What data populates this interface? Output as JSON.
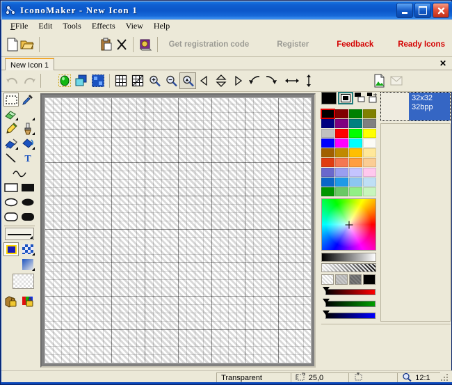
{
  "window": {
    "title": "IconoMaker - New Icon 1",
    "app_icon": "iconomaker-icon",
    "minimize_label": "",
    "maximize_label": "",
    "close_label": "✕"
  },
  "menubar": {
    "items": [
      {
        "label": "File",
        "accel": "F"
      },
      {
        "label": "Edit",
        "accel": "E"
      },
      {
        "label": "Tools",
        "accel": "T"
      },
      {
        "label": "Effects",
        "accel": "c"
      },
      {
        "label": "View",
        "accel": "V"
      },
      {
        "label": "Help",
        "accel": "H"
      }
    ]
  },
  "toolbar_main": {
    "buttons": [
      {
        "name": "new-icon-button",
        "icon": "new-document-icon"
      },
      {
        "name": "open-icon-button",
        "icon": "open-folder-icon"
      },
      {
        "name": "paste-button",
        "icon": "clipboard-paste-icon"
      },
      {
        "name": "delete-button",
        "icon": "delete-x-icon"
      },
      {
        "name": "library-button",
        "icon": "book-icon"
      }
    ],
    "get_registration_code": "Get registration code",
    "register": "Register",
    "feedback": "Feedback",
    "ready_icons": "Ready Icons",
    "disabled_color": "#9b9b94",
    "accent_color": "#d40000"
  },
  "tabs": {
    "items": [
      {
        "label": "New Icon 1",
        "active": true
      }
    ],
    "close_label": "✕"
  },
  "toolbar_edit": {
    "undo": {
      "name": "undo-button",
      "icon": "undo-arrow-icon",
      "enabled": false
    },
    "redo": {
      "name": "redo-button",
      "icon": "redo-arrow-icon",
      "enabled": false
    },
    "buttons": [
      {
        "name": "image-layer-button",
        "icon": "green-image-icon"
      },
      {
        "name": "copy-layer-button",
        "icon": "blue-layers-icon"
      },
      {
        "name": "select-image-button",
        "icon": "blue-selection-icon"
      },
      {
        "name": "grid-button",
        "icon": "grid-icon"
      },
      {
        "name": "pixel-grid-button",
        "icon": "pixel-grid-icon"
      },
      {
        "name": "zoom-in-button",
        "icon": "magnifier-plus-icon"
      },
      {
        "name": "zoom-out-button",
        "icon": "magnifier-minus-icon"
      },
      {
        "name": "zoom-fit-button",
        "icon": "magnifier-fit-icon",
        "pressed": true
      },
      {
        "name": "rotate-left-button",
        "icon": "triangle-left-icon"
      },
      {
        "name": "flip-vertical-button",
        "icon": "double-triangle-vertical-icon"
      },
      {
        "name": "rotate-right-button",
        "icon": "triangle-right-icon"
      },
      {
        "name": "rotate-ccw-button",
        "icon": "curve-arrow-left-icon"
      },
      {
        "name": "rotate-cw-button",
        "icon": "curve-arrow-right-icon"
      },
      {
        "name": "flip-horizontal-button",
        "icon": "arrow-horizontal-icon"
      },
      {
        "name": "stretch-vertical-button",
        "icon": "arrow-vertical-icon"
      },
      {
        "name": "import-image-button",
        "icon": "picture-page-icon"
      },
      {
        "name": "export-image-button",
        "icon": "send-image-icon",
        "enabled": false
      }
    ]
  },
  "tool_palette": {
    "rows": [
      [
        {
          "name": "tool-rect-select",
          "icon": "marquee-select-icon",
          "selected": true
        },
        {
          "name": "tool-eyedropper",
          "icon": "eyedropper-icon"
        }
      ],
      [
        {
          "name": "tool-eraser",
          "icon": "eraser-icon"
        },
        {
          "name": "tool-airbrush-small",
          "icon": "spray-icon"
        }
      ],
      [
        {
          "name": "tool-pencil",
          "icon": "pencil-icon"
        },
        {
          "name": "tool-brush",
          "icon": "brush-icon"
        }
      ],
      [
        {
          "name": "tool-fill-pattern",
          "icon": "pattern-fill-icon"
        },
        {
          "name": "tool-paint-bucket",
          "icon": "paint-bucket-icon"
        }
      ],
      [
        {
          "name": "tool-line",
          "icon": "line-icon"
        },
        {
          "name": "tool-text",
          "icon": "text-t-icon"
        }
      ],
      [
        {
          "name": "tool-curve",
          "icon": "curve-icon"
        }
      ],
      [
        {
          "name": "tool-rectangle-outline",
          "icon": "rectangle-outline-icon"
        },
        {
          "name": "tool-rectangle-filled",
          "icon": "rectangle-filled-icon"
        }
      ],
      [
        {
          "name": "tool-ellipse-outline",
          "icon": "ellipse-outline-icon"
        },
        {
          "name": "tool-ellipse-filled",
          "icon": "ellipse-filled-icon"
        }
      ],
      [
        {
          "name": "tool-roundrect-outline",
          "icon": "rounded-rect-outline-icon"
        },
        {
          "name": "tool-roundrect-filled",
          "icon": "rounded-rect-filled-icon"
        }
      ]
    ],
    "line_width_label": "line-width-selector",
    "fill_swatches": [
      {
        "name": "fill-solid-swatch",
        "icon": "solid-blue-swatch",
        "selected": true
      },
      {
        "name": "fill-pattern-swatch",
        "icon": "checker-blue-swatch"
      }
    ],
    "gradient_swatch": {
      "name": "fill-gradient-swatch",
      "icon": "gradient-blue-swatch"
    },
    "transparent_swatch": {
      "name": "transparent-swatch",
      "icon": "transparency-checker-swatch"
    },
    "lock_buttons": [
      {
        "name": "lock-image-button",
        "icon": "lock-image-icon"
      },
      {
        "name": "lock-color-button",
        "icon": "lock-color-icon"
      }
    ]
  },
  "palette": {
    "current_color": "#000000",
    "secondary_swatch": "secondary-color-swatch",
    "fg_bg_icon": "foreground-background-icon",
    "add_color_icon": "add-color-icon",
    "selected_index": 0,
    "colors": [
      "#000000",
      "#800000",
      "#008000",
      "#808000",
      "#000080",
      "#800080",
      "#008080",
      "#808080",
      "#c0c0c0",
      "#ff0000",
      "#00ff00",
      "#ffff00",
      "#0000ff",
      "#ff00ff",
      "#00ffff",
      "#fbfbf6",
      "#a06000",
      "#c08a00",
      "#ffbf00",
      "#ffe89a",
      "#e03c10",
      "#f47852",
      "#ff9e40",
      "#fbcd94",
      "#6a68cc",
      "#9a9ef0",
      "#c4c4ff",
      "#ffc8ee",
      "#0a66c8",
      "#1e9ae8",
      "#8cc6f0",
      "#bfdff5",
      "#009600",
      "#6ac864",
      "#92ef86",
      "#c8f5bd"
    ],
    "hsv_picker": "hsv-color-wheel",
    "gray_gradient": "grayscale-gradient",
    "checker_gradient": "checker-gradient",
    "patterns": [
      "pattern-light",
      "pattern-medium-light",
      "pattern-medium-dark",
      "pattern-solid-black"
    ],
    "channels": [
      {
        "name": "red-channel-slider",
        "color": "#ff0000"
      },
      {
        "name": "green-channel-slider",
        "color": "#00a000"
      },
      {
        "name": "blue-channel-slider",
        "color": "#0000ff"
      }
    ]
  },
  "icon_list": {
    "items": [
      {
        "size": "32x32",
        "depth": "32bpp",
        "selected": true
      }
    ]
  },
  "statusbar": {
    "mode": "Transparent",
    "cursor_icon": "cursor-position-icon",
    "position": "25,0",
    "selection_icon": "selection-size-icon",
    "selection": "",
    "zoom_icon": "magnifier-icon",
    "zoom": "12:1"
  }
}
